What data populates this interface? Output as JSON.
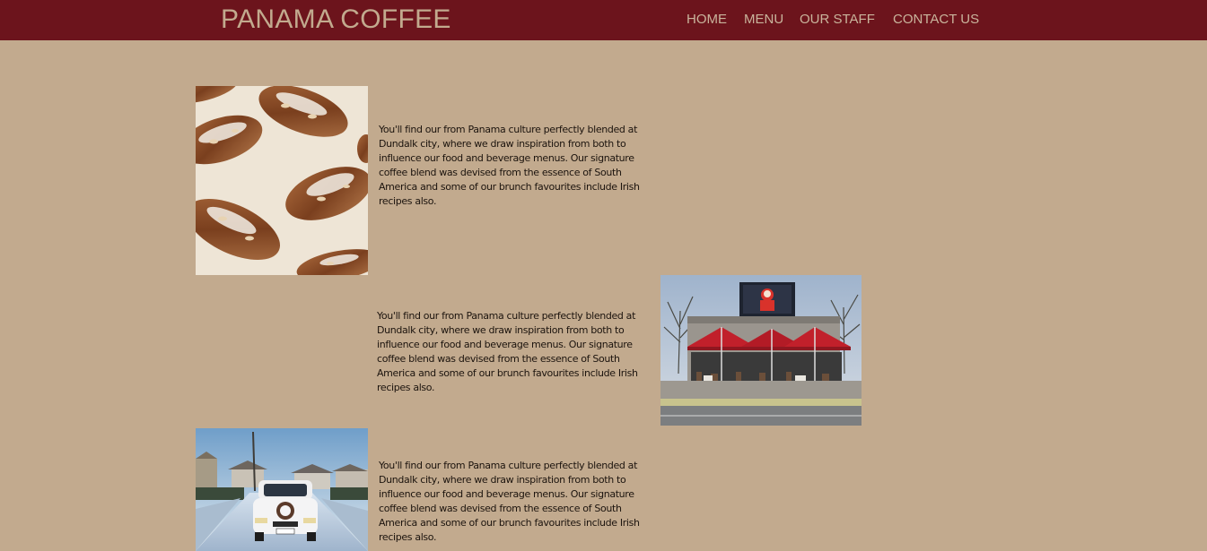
{
  "header": {
    "brand": "PANAMA COFFEE",
    "nav": [
      {
        "label": "HOME"
      },
      {
        "label": "MENU"
      },
      {
        "label": "OUR STAFF"
      },
      {
        "label": "CONTACT US"
      }
    ]
  },
  "sections": [
    {
      "image_subject": "almond croissants",
      "text": "You'll find our from Panama culture perfectly blended at Dundalk city, where we draw inspiration from both to influence our food and beverage menus. Our signature coffee blend was devised from the essence of South America and some of our brunch favourites include Irish recipes also."
    },
    {
      "image_subject": "cafe storefront with red parasols",
      "text": "You'll find our from Panama culture perfectly blended at Dundalk city, where we draw inspiration from both to influence our food and beverage menus. Our signature coffee blend was devised from the essence of South America and some of our brunch favourites include Irish recipes also."
    },
    {
      "image_subject": "delivery van on snowy street",
      "text": "You'll find our from Panama culture perfectly blended at Dundalk city, where we draw inspiration from both to influence our food and beverage menus. Our signature coffee blend was devised from the essence of South America and some of our brunch favourites include Irish recipes also."
    }
  ],
  "colors": {
    "navbar": "#6c141c",
    "background": "#c2aa8e",
    "brand_text": "#c2aa8e",
    "nav_text": "#c9b49c"
  }
}
